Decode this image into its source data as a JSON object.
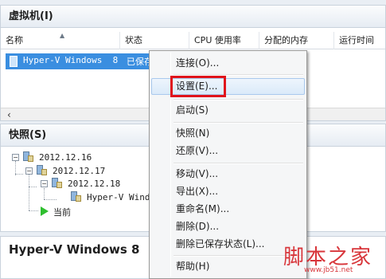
{
  "vm_section": {
    "title": "虚拟机(I)",
    "columns": [
      "名称",
      "状态",
      "CPU 使用率",
      "分配的内存",
      "运行时间"
    ],
    "rows": [
      {
        "name": "Hyper-V Windows  8",
        "state": "已保存"
      }
    ],
    "scroll_left_glyph": "‹"
  },
  "snapshot_section": {
    "title": "快照(S)",
    "nodes": [
      {
        "label": "2012.12.16",
        "level": 0
      },
      {
        "label": "2012.12.17",
        "level": 1
      },
      {
        "label": "2012.12.18",
        "level": 2
      },
      {
        "label": "Hyper-V Windo",
        "level": 3
      },
      {
        "label": "当前",
        "level": 1
      }
    ]
  },
  "bottom_section": {
    "title": "Hyper-V Windows  8"
  },
  "context_menu": {
    "items": [
      {
        "label": "连接(O)..."
      },
      {
        "label": "设置(E)...",
        "highlighted": true
      },
      {
        "label": "启动(S)"
      },
      {
        "label": "快照(N)"
      },
      {
        "label": "还原(V)..."
      },
      {
        "label": "移动(V)..."
      },
      {
        "label": "导出(X)..."
      },
      {
        "label": "重命名(M)..."
      },
      {
        "label": "删除(D)..."
      },
      {
        "label": "删除已保存状态(L)..."
      },
      {
        "label": "帮助(H)"
      }
    ]
  },
  "watermark": {
    "text": "脚本之家",
    "url": "www.jb51.net"
  },
  "colors": {
    "selection": "#3a8ee0",
    "highlight_outline": "#e0141b",
    "watermark": "#d8363b",
    "current_arrow": "#2fbf2f"
  }
}
